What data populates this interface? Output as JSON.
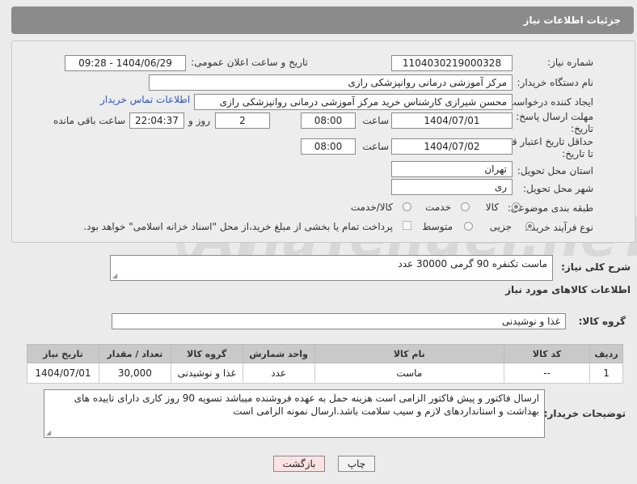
{
  "header": {
    "title": "جزئیات اطلاعات نیاز"
  },
  "form": {
    "need_number_label": "شماره نیاز:",
    "need_number": "1104030219000328",
    "announce_label": "تاریخ و ساعت اعلان عمومی:",
    "announce_value": "1404/06/29 - 09:28",
    "buyer_label": "نام دستگاه خریدار:",
    "buyer_value": "مرکز آموزشی درمانی روانپزشکی رازی",
    "creator_label": "ایجاد کننده درخواست:",
    "creator_value": "محسن شیرازی کارشناس خرید مرکز آموزشی درمانی روانپزشکی رازی",
    "contact_link": "اطلاعات تماس خریدار",
    "deadline_label_1": "مهلت ارسال پاسخ: تا",
    "deadline_label_2": "تاریخ:",
    "deadline_date": "1404/07/01",
    "time_label": "ساعت",
    "deadline_time": "08:00",
    "days_value": "2",
    "days_label": "روز و",
    "remaining_value": "22:04:37",
    "remaining_label": "ساعت باقی مانده",
    "validity_label_1": "حداقل تاریخ اعتبار قیمت:",
    "validity_label_2": "تا تاریخ:",
    "validity_date": "1404/07/02",
    "validity_time": "08:00",
    "province_label": "استان محل تحویل:",
    "province_value": "تهران",
    "city_label": "شهر محل تحویل:",
    "city_value": "ری",
    "category_label": "طبقه بندی موضوعی:",
    "category_options": [
      "کالا",
      "خدمت",
      "کالا/خدمت"
    ],
    "process_label": "نوع فرآیند خرید :",
    "process_options": [
      "جزیی",
      "متوسط"
    ],
    "payment_text": "پرداخت تمام یا بخشی از مبلغ خرید،از محل \"اسناد خزانه اسلامی\" خواهد بود."
  },
  "description": {
    "label": "شرح کلی نیاز:",
    "value": "ماست تکنفره 90 گرمی 30000 عدد"
  },
  "goods_section_title": "اطلاعات کالاهای مورد نیاز",
  "goods_group": {
    "label": "گروه کالا:",
    "value": "غذا و نوشیدنی"
  },
  "table": {
    "headers": [
      "ردیف",
      "کد کالا",
      "نام کالا",
      "واحد شمارش",
      "گروه کالا",
      "تعداد / مقدار",
      "تاریخ نیاز"
    ],
    "rows": [
      [
        "1",
        "--",
        "ماست",
        "عدد",
        "غذا و نوشیدنی",
        "30,000",
        "1404/07/01"
      ]
    ]
  },
  "buyer_notes": {
    "label": "توضیحات خریدار:",
    "value": "ارسال فاکتور و پیش فاکتور الزامی است هزینه حمل به عهده فروشنده میباشد تسویه 90 روز کاری دارای تاییده های بهداشت و استانداردهای  لازم و سیب سلامت باشد.ارسال نمونه الزامی است"
  },
  "buttons": {
    "print": "چاپ",
    "back": "بازگشت"
  },
  "colors": {
    "header": "#8b8b8b",
    "link": "#2a55c8",
    "back_button": "#fbe3e3"
  }
}
